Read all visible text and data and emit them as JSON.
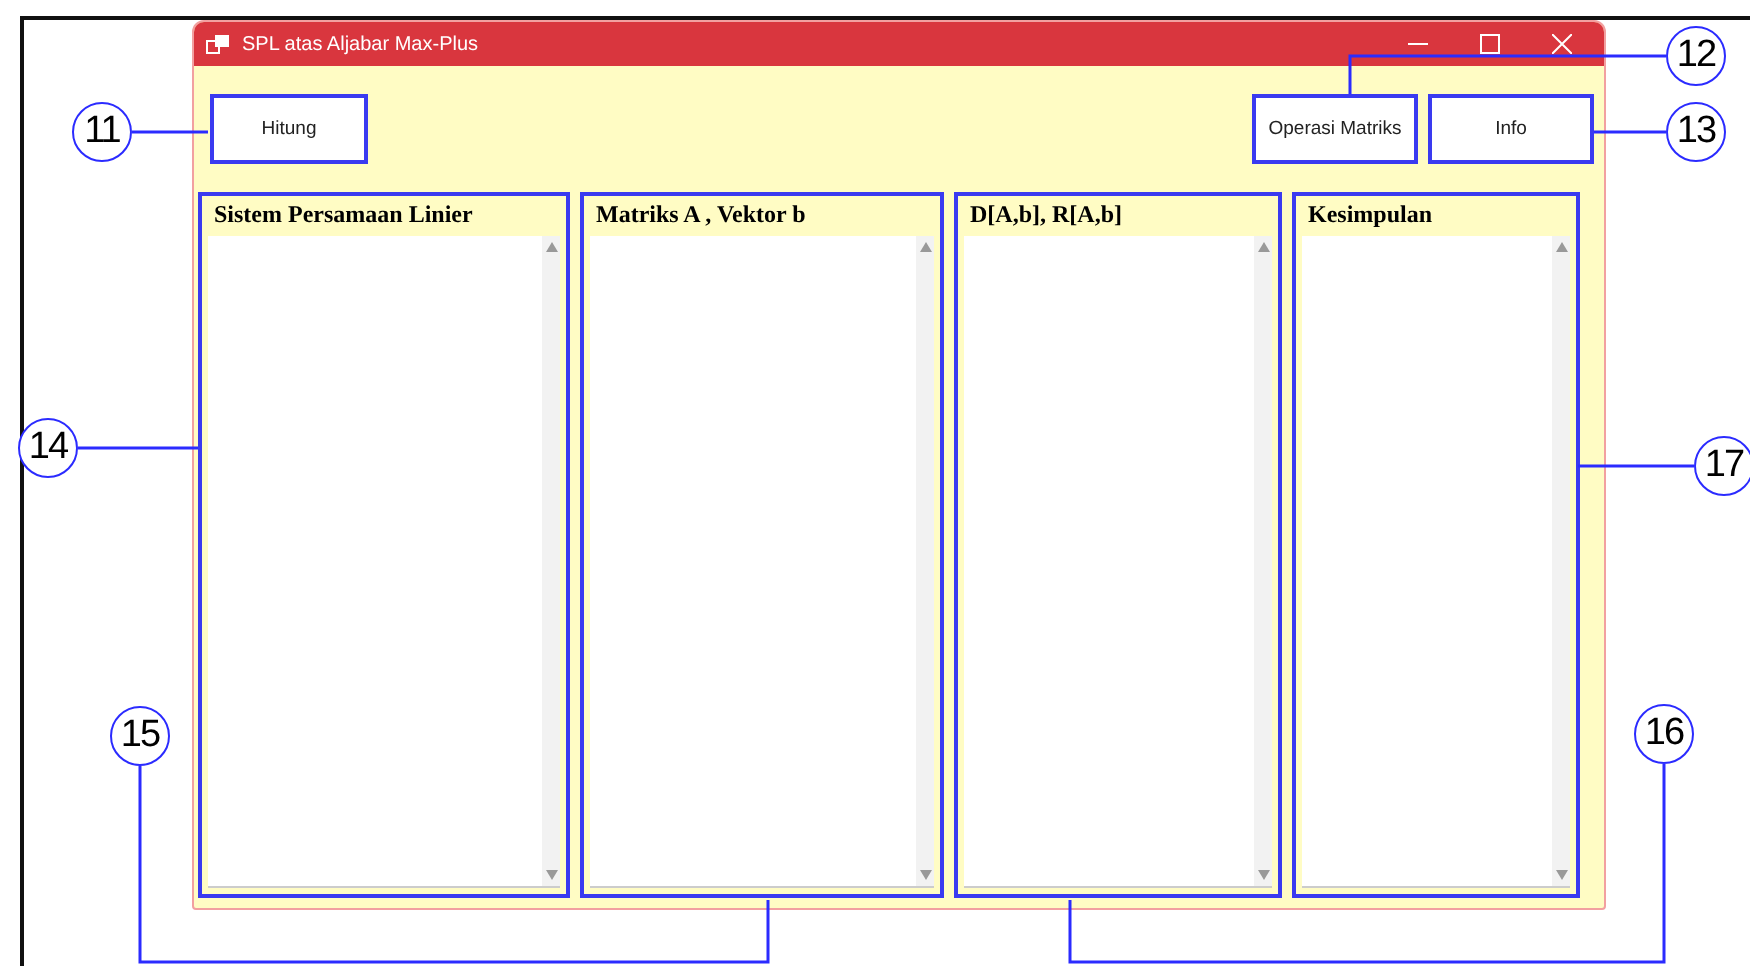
{
  "window": {
    "title": "SPL atas Aljabar Max-Plus"
  },
  "buttons": [
    {
      "label": "Hitung",
      "kind": "left"
    },
    {
      "label": "Operasi Matriks",
      "kind": "right"
    },
    {
      "label": "Info",
      "kind": "right"
    }
  ],
  "panels": [
    {
      "title": "Sistem Persamaan Linier"
    },
    {
      "title": "Matriks A , Vektor b"
    },
    {
      "title": "D[A,b], R[A,b]"
    },
    {
      "title": "Kesimpulan"
    }
  ],
  "callouts": [
    {
      "label": "11"
    },
    {
      "label": "12"
    },
    {
      "label": "13"
    },
    {
      "label": "14"
    },
    {
      "label": "15"
    },
    {
      "label": "16"
    },
    {
      "label": "17"
    }
  ]
}
